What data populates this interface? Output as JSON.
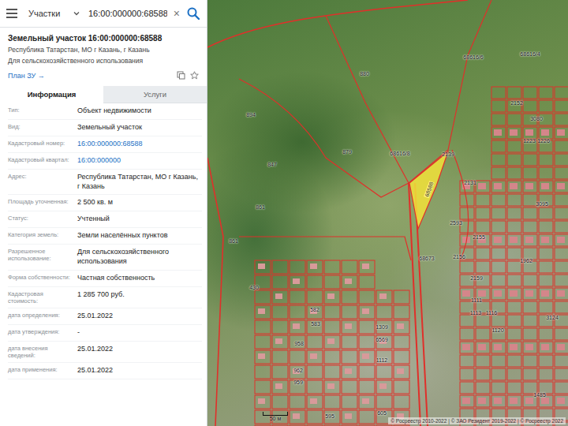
{
  "search": {
    "category": "Участки",
    "query": "16:00:000000:68588",
    "clear": "×"
  },
  "header": {
    "title": "Земельный участок 16:00:000000:68588",
    "address": "Республика Татарстан, МО г Казань, г Казань",
    "purpose": "Для сельскохозяйственного использования",
    "plan_link": "План ЗУ →"
  },
  "tabs": [
    {
      "label": "Информация",
      "selected": true
    },
    {
      "label": "Услуги",
      "selected": false
    }
  ],
  "fields": [
    {
      "label": "Тип:",
      "value": "Объект недвижимости",
      "kind": "text"
    },
    {
      "label": "Вид:",
      "value": "Земельный участок",
      "kind": "text"
    },
    {
      "label": "Кадастровый номер:",
      "value": "16:00:000000:68588",
      "kind": "link"
    },
    {
      "label": "Кадастровый квартал:",
      "value": "16:00:000000",
      "kind": "link"
    },
    {
      "label": "Адрес:",
      "value": "Республика Татарстан, МО г Казань, г Казань",
      "kind": "text"
    },
    {
      "label": "Площадь уточненная:",
      "value": "2 500 кв. м",
      "kind": "text"
    },
    {
      "label": "Статус:",
      "value": "Учтенный",
      "kind": "text"
    },
    {
      "label": "Категория земель:",
      "value": "Земли населённых пунктов",
      "kind": "text"
    },
    {
      "label": "Разрешенное использование:",
      "value": "Для сельскохозяйственного использования",
      "kind": "text"
    },
    {
      "label": "Форма собственности:",
      "value": "Частная собственность",
      "kind": "text"
    },
    {
      "label": "Кадастровая стоимость:",
      "value": "1 285 700 руб.",
      "kind": "text"
    },
    {
      "label": "дата определения:",
      "value": "25.01.2022",
      "kind": "text"
    },
    {
      "label": "дата утверждения:",
      "value": "-",
      "kind": "text"
    },
    {
      "label": "дата внесения сведений:",
      "value": "25.01.2022",
      "kind": "text"
    },
    {
      "label": "дата применения:",
      "value": "25.01.2022",
      "kind": "text"
    }
  ],
  "map": {
    "selected_parcel": "68588",
    "labels": [
      "68616/6",
      "68616/4",
      "880",
      "894",
      "879",
      "68616/8",
      "847",
      "861",
      "861",
      "68673",
      "2593",
      "2155",
      "2156",
      "2159",
      "2139",
      "2131",
      "2152",
      "3080",
      "1223",
      "1226",
      "3095",
      "1962",
      "3124",
      "1111",
      "1113",
      "1116",
      "1120",
      "1485",
      "430",
      "582",
      "583",
      "958",
      "962",
      "959",
      "1309",
      "6569",
      "1112",
      "605",
      "595"
    ],
    "scale": "50 м",
    "attribution": "© Росреестр 2010-2022 | © ЗАО Резидент 2019-2022 | © Росреестр 2022"
  }
}
